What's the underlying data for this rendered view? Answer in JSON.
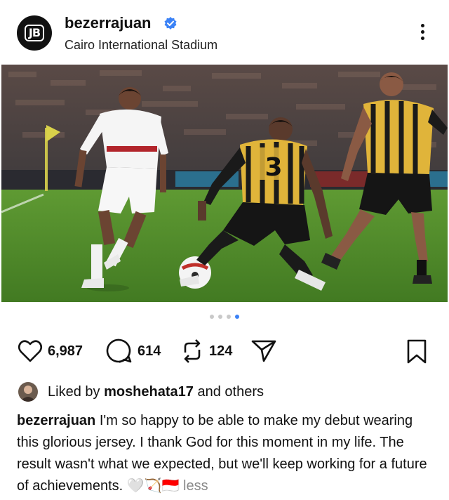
{
  "post": {
    "avatar_text": "JB",
    "username": "bezerrajuan",
    "location": "Cairo International Stadium",
    "likes": "6,987",
    "comments": "614",
    "reposts": "124",
    "liked_by_prefix": "Liked by ",
    "liked_by_user": "moshehata17",
    "liked_by_suffix": " and others",
    "caption_user": "bezerrajuan",
    "caption_text": " I'm so happy to be able to make my debut wearing this glorious jersey. I thank God for this moment in my life. The result wasn't what we expected, but we'll keep working for a future of achievements. 🤍🏹🇮🇩 ",
    "less_label": "less",
    "carousel": {
      "count": 4,
      "active_index": 3
    },
    "jersey_number": "3"
  },
  "colors": {
    "accent_blue": "#3b82f6",
    "pitch_green": "#4f8a2e",
    "home_kit": "#ffffff",
    "away_kit": "#e0b43a"
  },
  "icons": [
    "verified-badge-icon",
    "more-options-icon",
    "heart-icon",
    "comment-icon",
    "repost-icon",
    "share-icon",
    "bookmark-icon"
  ]
}
